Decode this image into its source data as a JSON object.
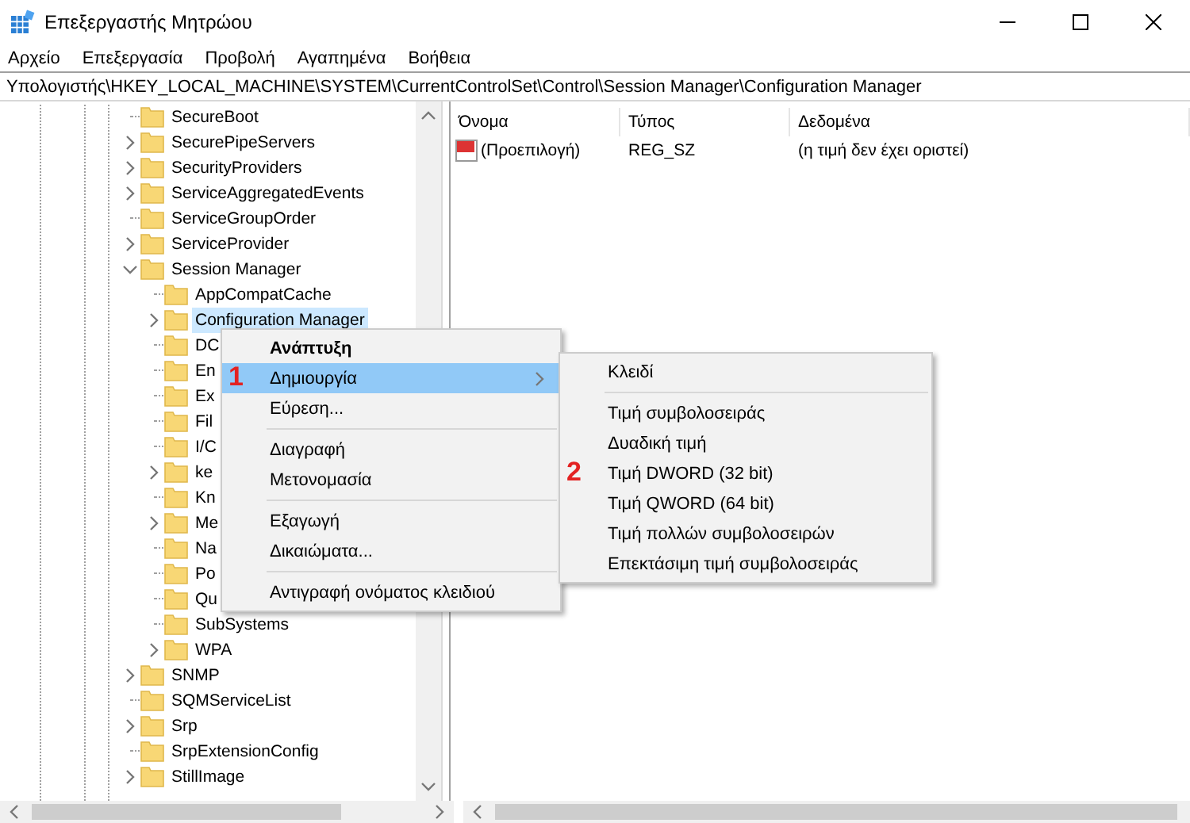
{
  "window": {
    "title": "Επεξεργαστής Μητρώου"
  },
  "menu_bar": [
    "Αρχείο",
    "Επεξεργασία",
    "Προβολή",
    "Αγαπημένα",
    "Βοήθεια"
  ],
  "address_bar": {
    "value": "Υπολογιστής\\HKEY_LOCAL_MACHINE\\SYSTEM\\CurrentControlSet\\Control\\Session Manager\\Configuration Manager"
  },
  "tree": [
    {
      "label": "SecureBoot",
      "has_children": false,
      "selected": false
    },
    {
      "label": "SecurePipeServers",
      "has_children": true,
      "expanded": false,
      "selected": false
    },
    {
      "label": "SecurityProviders",
      "has_children": true,
      "expanded": false,
      "selected": false
    },
    {
      "label": "ServiceAggregatedEvents",
      "has_children": true,
      "expanded": false,
      "selected": false
    },
    {
      "label": "ServiceGroupOrder",
      "has_children": false,
      "selected": false
    },
    {
      "label": "ServiceProvider",
      "has_children": true,
      "expanded": false,
      "selected": false
    },
    {
      "label": "Session Manager",
      "has_children": true,
      "expanded": true,
      "selected": false,
      "children": [
        {
          "label": "AppCompatCache",
          "has_children": false,
          "selected": false
        },
        {
          "label": "Configuration Manager",
          "has_children": true,
          "expanded": false,
          "selected": true
        },
        {
          "label": "DC",
          "has_children": false,
          "selected": false
        },
        {
          "label": "En",
          "has_children": false,
          "selected": false
        },
        {
          "label": "Ex",
          "has_children": false,
          "selected": false
        },
        {
          "label": "Fil",
          "has_children": false,
          "selected": false
        },
        {
          "label": "I/C",
          "has_children": false,
          "selected": false
        },
        {
          "label": "ke",
          "has_children": true,
          "expanded": false,
          "selected": false
        },
        {
          "label": "Kn",
          "has_children": false,
          "selected": false
        },
        {
          "label": "Me",
          "has_children": true,
          "expanded": false,
          "selected": false
        },
        {
          "label": "Na",
          "has_children": false,
          "selected": false
        },
        {
          "label": "Po",
          "has_children": false,
          "selected": false
        },
        {
          "label": "Qu",
          "has_children": false,
          "selected": false
        },
        {
          "label": "SubSystems",
          "has_children": false,
          "selected": false
        },
        {
          "label": "WPA",
          "has_children": true,
          "expanded": false,
          "selected": false
        }
      ]
    },
    {
      "label": "SNMP",
      "has_children": true,
      "expanded": false,
      "selected": false
    },
    {
      "label": "SQMServiceList",
      "has_children": false,
      "selected": false
    },
    {
      "label": "Srp",
      "has_children": true,
      "expanded": false,
      "selected": false
    },
    {
      "label": "SrpExtensionConfig",
      "has_children": false,
      "selected": false
    },
    {
      "label": "StillImage",
      "has_children": true,
      "expanded": false,
      "selected": false
    }
  ],
  "values_table": {
    "columns": [
      "Όνομα",
      "Τύπος",
      "Δεδομένα"
    ],
    "rows": [
      {
        "name": "(Προεπιλογή)",
        "type": "REG_SZ",
        "data": "(η τιμή δεν έχει οριστεί)"
      }
    ]
  },
  "context_menu": [
    {
      "kind": "item",
      "label": "Ανάπτυξη",
      "bold": true,
      "submenu": false,
      "selected": false
    },
    {
      "kind": "item",
      "label": "Δημιουργία",
      "bold": false,
      "submenu": true,
      "selected": true,
      "annotation": "1"
    },
    {
      "kind": "item",
      "label": "Εύρεση...",
      "bold": false,
      "submenu": false,
      "selected": false
    },
    {
      "kind": "separator"
    },
    {
      "kind": "item",
      "label": "Διαγραφή",
      "bold": false,
      "submenu": false,
      "selected": false
    },
    {
      "kind": "item",
      "label": "Μετονομασία",
      "bold": false,
      "submenu": false,
      "selected": false
    },
    {
      "kind": "separator"
    },
    {
      "kind": "item",
      "label": "Εξαγωγή",
      "bold": false,
      "submenu": false,
      "selected": false
    },
    {
      "kind": "item",
      "label": "Δικαιώματα...",
      "bold": false,
      "submenu": false,
      "selected": false
    },
    {
      "kind": "separator"
    },
    {
      "kind": "item",
      "label": "Αντιγραφή ονόματος κλειδιού",
      "bold": false,
      "submenu": false,
      "selected": false
    }
  ],
  "submenu": [
    {
      "kind": "item",
      "label": "Κλειδί",
      "selected": false
    },
    {
      "kind": "separator"
    },
    {
      "kind": "item",
      "label": "Τιμή συμβολοσειράς",
      "selected": false
    },
    {
      "kind": "item",
      "label": "Δυαδική τιμή",
      "selected": false
    },
    {
      "kind": "item",
      "label": "Τιμή DWORD (32 bit)",
      "selected": false,
      "annotation": "2"
    },
    {
      "kind": "item",
      "label": "Τιμή QWORD (64 bit)",
      "selected": false
    },
    {
      "kind": "item",
      "label": "Τιμή πολλών συμβολοσειρών",
      "selected": false
    },
    {
      "kind": "item",
      "label": "Επεκτάσιμη τιμή συμβολοσειράς",
      "selected": false
    }
  ]
}
